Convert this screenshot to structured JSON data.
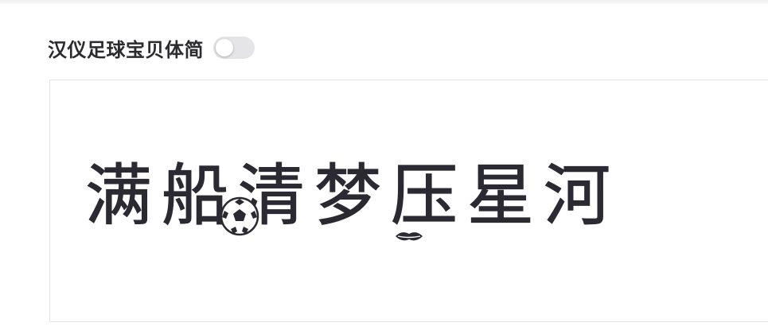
{
  "font": {
    "name": "汉仪足球宝贝体简",
    "enabled": false
  },
  "preview": {
    "text": "满船清梦压星河"
  },
  "colors": {
    "title": "#2b2b2f",
    "toggle_off": "#e5e5e8",
    "preview_ink": "#2b2a33",
    "border": "#e4e4e7"
  }
}
